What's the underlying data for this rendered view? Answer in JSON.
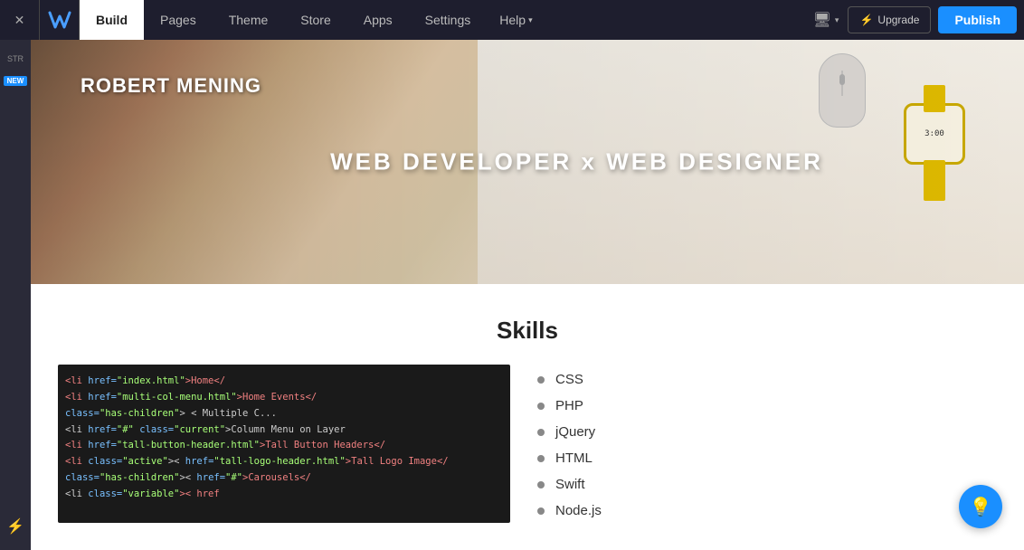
{
  "topnav": {
    "build_label": "Build",
    "pages_label": "Pages",
    "theme_label": "Theme",
    "store_label": "Store",
    "apps_label": "Apps",
    "settings_label": "Settings",
    "help_label": "Help",
    "upgrade_label": "Upgrade",
    "publish_label": "Publish"
  },
  "hero": {
    "name": "ROBERT MENING",
    "title": "WEB DEVELOPER x WEB DESIGNER",
    "watch_time": "3:00"
  },
  "skills": {
    "section_title": "Skills",
    "items": [
      {
        "label": "CSS"
      },
      {
        "label": "PHP"
      },
      {
        "label": "jQuery"
      },
      {
        "label": "HTML"
      },
      {
        "label": "Swift"
      },
      {
        "label": "Node.js"
      }
    ]
  },
  "sidebar": {
    "str_label": "STR",
    "new_badge": "NEW"
  },
  "code_lines": [
    {
      "text": "<li  href=\"index.html\">Home</",
      "colors": [
        "#f08080",
        "#79c0ff",
        "#a8ff78",
        "#f08080"
      ]
    },
    {
      "text": "<li  href=\"multi-col-menu.html\">Home Events</",
      "colors": [
        "#f08080",
        "#79c0ff",
        "#a8ff78"
      ]
    },
    {
      "text": "    class=\"has-children\"> < Multiple C...",
      "colors": [
        "#ccc",
        "#79c0ff",
        "#ccc"
      ]
    },
    {
      "text": "    <li   href=\"#\" class=\"current\">Column Menu on Layer",
      "colors": [
        "#f08080",
        "#ccc",
        "#79c0ff"
      ]
    },
    {
      "text": "<li  href=\"tall-button-header.html\">Tall Button Headers</",
      "colors": [
        "#f08080",
        "#79c0ff"
      ]
    },
    {
      "text": "<li  class=\"active\">< href=\"tall-logo-header.html\">Tall Logo Image</",
      "colors": [
        "#f08080",
        "#79c0ff",
        "#a8ff78"
      ]
    },
    {
      "text": "",
      "colors": []
    },
    {
      "text": "    class=\"has-children\">< href=\"#\">Carousels</",
      "colors": [
        "#ccc",
        "#f08080",
        "#79c0ff"
      ]
    },
    {
      "text": "    <li class=\"variable\">< href",
      "colors": [
        "#ccc",
        "#f08080"
      ]
    }
  ],
  "icons": {
    "close": "✕",
    "upgrade_bolt": "⚡",
    "display": "🖥",
    "bulb": "💡"
  }
}
